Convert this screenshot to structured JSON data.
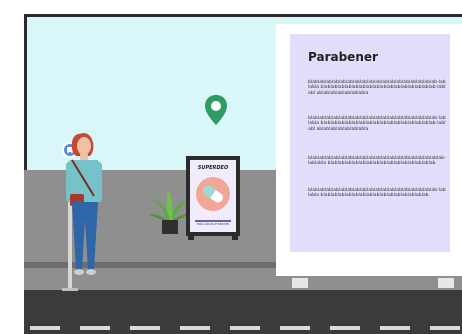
{
  "billboard": {
    "title": "Parabener",
    "paragraphs": [
      "blablablablablablablablablablablablablablablablablablab-lablabla blablablablablablablablablablablablablablablablab-lablabl ablablablablablablabla",
      "blablablablablablablablablablablablablablablablablablab-lablabla blablablablablablablablablablablablablablablablab-lablabl ablablablablablablabla",
      "blablablablablablablablablablablablablablablablablablablab-lablabla blablablablablablablablablablablablablablablab",
      "blablablablablablablablablablablablablablablablablablab-lablabla blablablablablablablablablablablablablablablab"
    ]
  },
  "poster": {
    "title": "SUPERDEO",
    "tagline": "ENGLAND BLUE BREWER"
  },
  "colors": {
    "sky": "#d9f7f8",
    "wall": "#8f8f8f",
    "road": "#3b3b3b",
    "panel": "#e3dcfa",
    "pin": "#2f9a63",
    "shirt": "#77c1c9",
    "jeans": "#2f66a8",
    "hair": "#c64a33"
  },
  "icons": [
    "location-pin-icon",
    "bus-stop-icon",
    "pill-icon",
    "plant-icon"
  ]
}
